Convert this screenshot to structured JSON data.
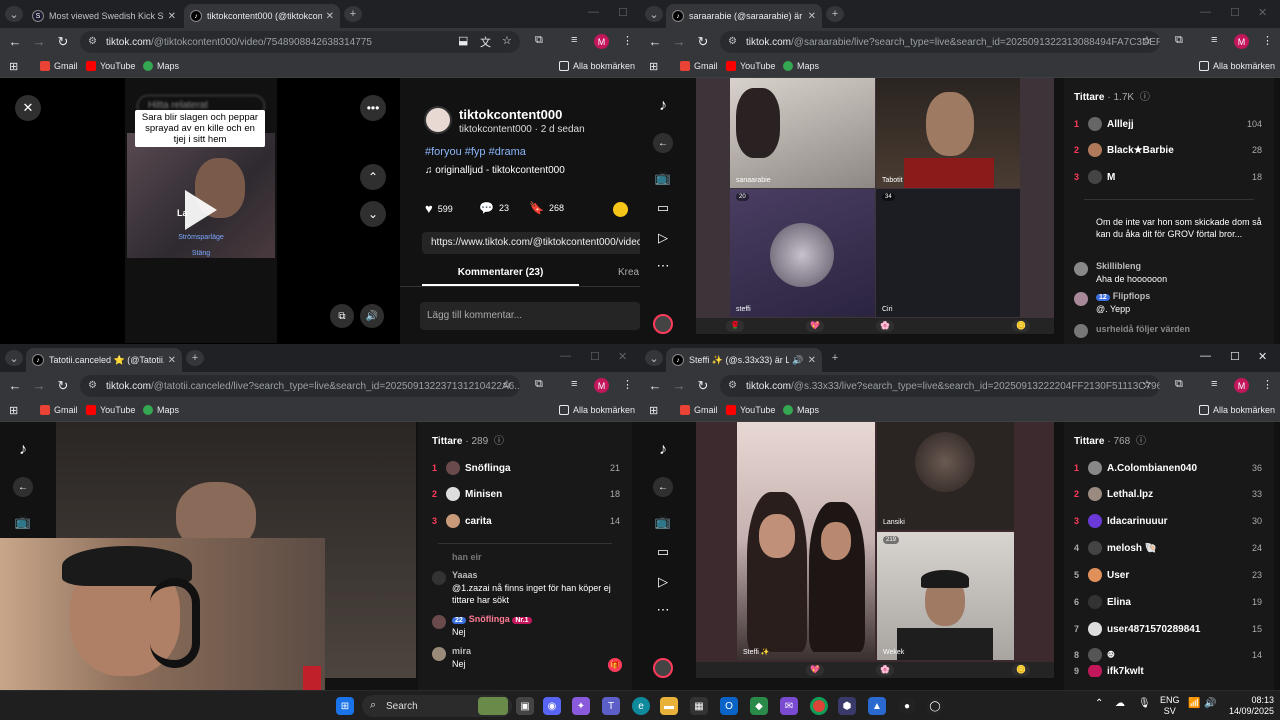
{
  "win1": {
    "tabs": [
      {
        "title": "Most viewed Swedish Kick Strea"
      },
      {
        "title": "tiktokcontent000 (@tiktokcont"
      }
    ],
    "url_host": "tiktok.com",
    "url_path": "/@tiktokcontent000/video/7548908842638314775",
    "bookmarks": [
      "Gmail",
      "YouTube",
      "Maps"
    ],
    "all_bookmarks": "Alla bokmärken",
    "video": {
      "header_blurred": "Hitta relaterat",
      "caption": "Sara blir slagen och peppar sprayad av en kille och en tjej i sitt hem",
      "overlay_main": "La",
      "overlay_link1": "Strömsparläge",
      "overlay_link2": "Stäng"
    },
    "author": {
      "name": "tiktokcontent000",
      "meta": "tiktokcontent000 · 2 d sedan"
    },
    "hashtags": "#foryou #fyp #drama",
    "sound": "originalljud - tiktokcontent000",
    "likes": "599",
    "comments_count": "23",
    "saves": "268",
    "share_url": "https://www.tiktok.com/@tiktokcontent000/video",
    "tab_comments": "Kommentarer (23)",
    "tab_creators": "Krea",
    "comment_placeholder": "Lägg till kommentar..."
  },
  "win2": {
    "tab": "saraarabie (@saraarabie) är LIVE",
    "url_host": "tiktok.com",
    "url_path": "/@saraarabie/live?search_type=live&search_id=20250913223130884​94FA7C3DEF...",
    "bookmarks": [
      "Gmail",
      "YouTube",
      "Maps"
    ],
    "all_bookmarks": "Alla bokmärken",
    "cells": [
      {
        "label": "sanaarabie"
      },
      {
        "label": "Tabotit"
      },
      {
        "label": "steffi",
        "badge": "20"
      },
      {
        "label": "Ciri",
        "badge": "34"
      }
    ],
    "viewers_title": "Tittare",
    "viewers_count": "· 1.7K",
    "viewers": [
      {
        "rank": "1",
        "name": "Alllejj",
        "count": "104"
      },
      {
        "rank": "2",
        "name": "Black★Barbie",
        "count": "28"
      },
      {
        "rank": "3",
        "name": "M",
        "count": "18"
      }
    ],
    "comments": [
      {
        "name": "",
        "text": "Om de inte var hon som skickade dom så kan du åka dit för GROV förtal bror..."
      },
      {
        "name": "Skillibleng",
        "text": "Aha de hoooooon"
      },
      {
        "name": "Flipflops",
        "tag": "12",
        "text": "@. Yepp"
      },
      {
        "name": "usrheidå",
        "text": "följer värden"
      }
    ]
  },
  "win3": {
    "tab": "Tatotii.canceled ⭐ (@Tatotii.ca",
    "url_host": "tiktok.com",
    "url_path": "/@tatotii.canceled/live?search_type=live&search_id=20250913223713121042​2A6...",
    "bookmarks": [
      "Gmail",
      "YouTube",
      "Maps"
    ],
    "all_bookmarks": "Alla bokmärken",
    "viewers_title": "Tittare",
    "viewers_count": "· 289",
    "viewers": [
      {
        "rank": "1",
        "name": "Snöflinga",
        "count": "21"
      },
      {
        "rank": "2",
        "name": "Minisen",
        "count": "18"
      },
      {
        "rank": "3",
        "name": "carita",
        "count": "14"
      }
    ],
    "comments": [
      {
        "name": "han eir",
        "text": ""
      },
      {
        "name": "Yaaas",
        "text": "@1.zazai nå finns inget för han köper ej tittare har sökt"
      },
      {
        "name": "Snöflinga",
        "tag": "22",
        "tag2": "Nr.1",
        "text": "Nej"
      },
      {
        "name": "mira",
        "text": "Nej"
      }
    ]
  },
  "win4": {
    "tab": "Steffi ✨ (@s.33x33) är LIVE",
    "url_host": "tiktok.com",
    "url_path": "/@s.33x33/live?search_type=live&search_id=20250913222204FF2130F51113C796...",
    "bookmarks": [
      "Gmail",
      "YouTube",
      "Maps"
    ],
    "all_bookmarks": "Alla bokmärken",
    "cells": [
      {
        "label": "Steffi ✨"
      },
      {
        "label": "Lansiki"
      },
      {
        "label": "Wekek",
        "badge": "219"
      }
    ],
    "viewers_title": "Tittare",
    "viewers_count": "· 768",
    "viewers": [
      {
        "rank": "1",
        "name": "A.Colombianen040",
        "count": "36"
      },
      {
        "rank": "2",
        "name": "Lethal.lpz",
        "count": "33"
      },
      {
        "rank": "3",
        "name": "Idacarinuuur",
        "count": "30"
      },
      {
        "rank": "4",
        "name": "melosh 🐚",
        "count": "24"
      },
      {
        "rank": "5",
        "name": "User",
        "count": "23"
      },
      {
        "rank": "6",
        "name": "Elina",
        "count": "19"
      },
      {
        "rank": "7",
        "name": "user4871570289841",
        "count": "15"
      },
      {
        "rank": "8",
        "name": "ꔮ",
        "count": "14"
      },
      {
        "rank": "9",
        "name": "ifk7kwlt",
        "count": ""
      }
    ]
  },
  "taskbar": {
    "search": "Search",
    "lang1": "ENG",
    "lang2": "SV",
    "time": "08:13",
    "date": "14/09/2025"
  }
}
